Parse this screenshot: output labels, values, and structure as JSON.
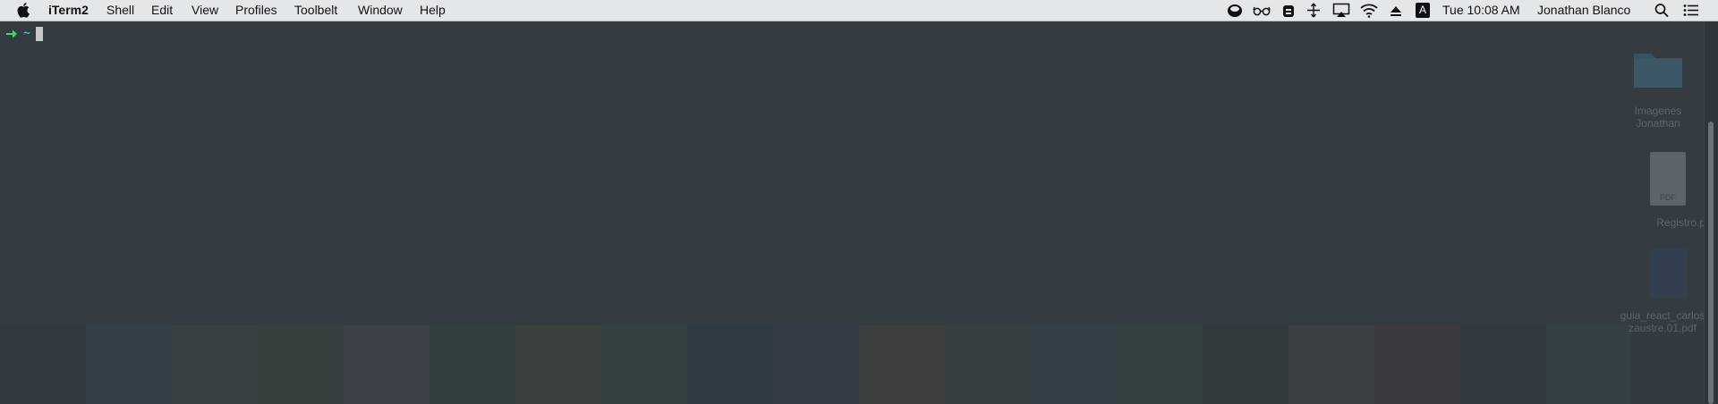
{
  "menubar": {
    "apple_icon": "apple-icon",
    "app_name": "iTerm2",
    "menus": [
      "Shell",
      "Edit",
      "View",
      "Profiles",
      "Toolbelt",
      "Window",
      "Help"
    ],
    "status_icons": [
      "dropbox-icon",
      "glasses-icon",
      "backpack-icon",
      "move-arrows-icon",
      "airplay-icon",
      "wifi-icon",
      "eject-icon",
      "input-source-icon"
    ],
    "input_source_letter": "A",
    "clock": "Tue 10:08 AM",
    "user": "Jonathan Blanco",
    "spotlight_icon": "search-icon",
    "notification_icon": "notification-center-icon"
  },
  "terminal": {
    "prompt_symbol": "➜",
    "cwd": "~"
  },
  "desktop_items": [
    {
      "label_line1": "Imagenes",
      "label_line2": "Jonathan",
      "icon": "folder-icon"
    },
    {
      "label_line1": "Registro.pdf",
      "label_line2": "",
      "icon": "pdf-file-icon",
      "badge": "PDF"
    },
    {
      "label_line1": "guia_react_carlos",
      "label_line2": "zaustre.01.pdf",
      "icon": "pdf-file-icon"
    }
  ],
  "wallpaper_colors": [
    "#2e4f64",
    "#4c5a3e",
    "#43542b",
    "#735d6b",
    "#2d4f26",
    "#625a1e",
    "#2a4e37",
    "#1a3048",
    "#2a3c57",
    "#6b5020",
    "#4b5434",
    "#35495a",
    "#3b5638",
    "#263a30",
    "#6e4f53",
    "#6a2a2a",
    "#2d3136",
    "#3e4e5e"
  ],
  "colors": {
    "menubar_bg": "#e3e7ea",
    "terminal_bg": "#343c42",
    "prompt_arrow": "#3fd96b",
    "cwd": "#2fc8c8"
  }
}
